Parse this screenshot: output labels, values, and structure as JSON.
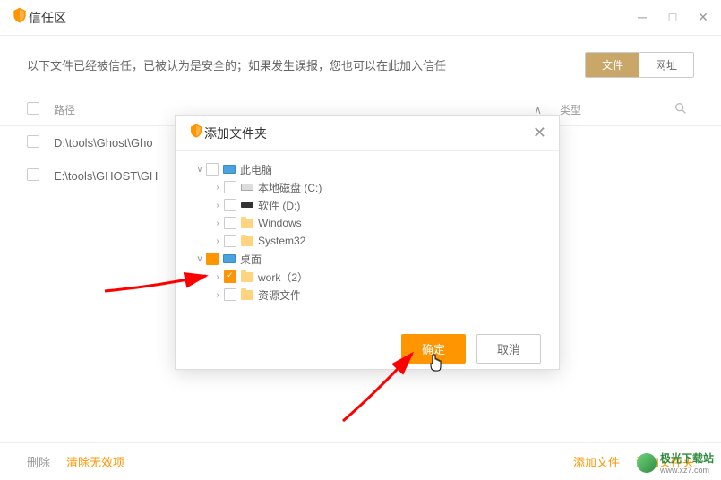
{
  "window": {
    "title": "信任区"
  },
  "description": "以下文件已经被信任，已被认为是安全的；如果发生误报，您也可以在此加入信任",
  "tabs": {
    "file": "文件",
    "url": "网址"
  },
  "columns": {
    "path": "路径",
    "type": "类型"
  },
  "rows": [
    {
      "path": "D:\\tools\\Ghost\\Gho"
    },
    {
      "path": "E:\\tools\\GHOST\\GH"
    }
  ],
  "dialog": {
    "title": "添加文件夹",
    "ok": "确定",
    "cancel": "取消",
    "tree": {
      "root": "此电脑",
      "disk_c": "本地磁盘 (C:)",
      "disk_d": "软件 (D:)",
      "windows": "Windows",
      "system32": "System32",
      "desktop": "桌面",
      "work": "work（2）",
      "resource": "资源文件"
    }
  },
  "footer": {
    "delete": "删除",
    "clear": "清除无效项",
    "add_file": "添加文件",
    "add_folder": "添加文件夹"
  },
  "watermark": {
    "name": "极光下载站",
    "url": "www.xz7.com"
  }
}
